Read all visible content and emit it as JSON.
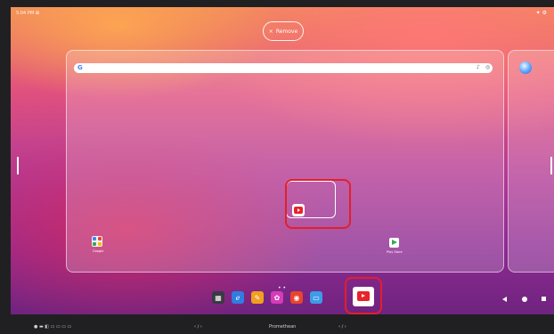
{
  "status_bar": {
    "time": "5:04 PM ⊠",
    "icons": "✦ ⚙"
  },
  "remove_button": {
    "icon": "×",
    "label": "Remove"
  },
  "search_bar": {
    "google_icon": "G",
    "mic_icon": "♪",
    "lens_icon": "◎"
  },
  "home_apps": {
    "google_folder_label": "Google",
    "play_store_label": "Play Store"
  },
  "dock": {
    "page_indicator": "• •",
    "apps": [
      "dashboard-app",
      "edge-app",
      "whiteboard-app",
      "media-app",
      "recorder-app",
      "screen-app",
      "youtube-app"
    ]
  },
  "bezel": {
    "left_controls": "● ▬ ◧ ▭ ▭ ▭ ▭",
    "brand": "Promethean",
    "left_dots": "‹ ∕ ›",
    "right_dots": "‹ ∕ ›"
  },
  "colors": {
    "highlight": "#e51e2a",
    "youtube": "#e8232a"
  }
}
